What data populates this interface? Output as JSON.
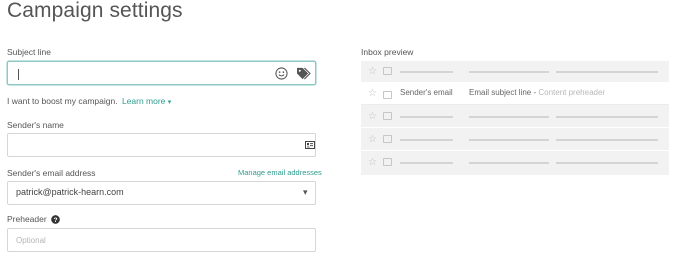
{
  "header": {
    "title": "Campaign settings"
  },
  "subject": {
    "label": "Subject line",
    "value": "",
    "boost_text": "I want to boost my campaign.",
    "learn_more": "Learn more"
  },
  "sender_name": {
    "label": "Sender's name",
    "value": ""
  },
  "sender_email": {
    "label": "Sender's email address",
    "manage_link": "Manage email addresses",
    "selected": "patrick@patrick-hearn.com"
  },
  "preheader": {
    "label": "Preheader",
    "placeholder": "Optional"
  },
  "inbox_preview": {
    "label": "Inbox preview",
    "sender": "Sender's email",
    "subject": "Email subject line",
    "separator": " - ",
    "preheader": "Content preheader"
  },
  "colors": {
    "accent": "#2d9c8f",
    "focus_border": "#8fc9c4",
    "preview_bg": "#f2f2f2"
  },
  "icons": [
    "emoji-icon",
    "tag-icon",
    "contact-card-icon",
    "chevron-down-icon",
    "help-icon",
    "star-icon",
    "flag-icon"
  ]
}
